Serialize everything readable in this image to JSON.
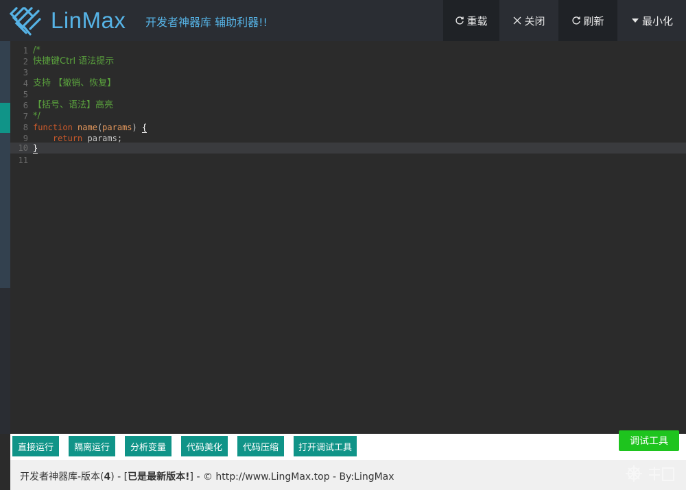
{
  "header": {
    "brand": "LinMax",
    "slogan": "开发者神器库 辅助利器!!",
    "nav": [
      {
        "label": "重载",
        "icon": "reload-icon"
      },
      {
        "label": "关闭",
        "icon": "close-icon"
      },
      {
        "label": "刷新",
        "icon": "refresh-icon"
      },
      {
        "label": "最小化",
        "icon": "caret-down-icon"
      }
    ]
  },
  "editor": {
    "lines": [
      "1",
      "2",
      "3",
      "4",
      "5",
      "6",
      "7",
      "8",
      "9",
      "10",
      "11"
    ],
    "code": {
      "l1": "/*",
      "l2": "快捷键Ctrl 语法提示",
      "l4": "支持 【撤销、恢复】",
      "l6": "【括号、语法】高亮",
      "l7": "*/",
      "l8_kw": "function",
      "l8_fn": "name",
      "l8_open": "(",
      "l8_param": "params",
      "l8_close": ") ",
      "l8_brace": "{",
      "l9_indent": "    ",
      "l9_kw": "return",
      "l9_rest": " params;",
      "l10": "}"
    }
  },
  "toolbar": {
    "buttons": [
      "直接运行",
      "隔离运行",
      "分析变量",
      "代码美化",
      "代码压缩",
      "打开调试工具"
    ],
    "debug": "调试工具"
  },
  "footer": {
    "prefix": "开发者神器库-版本(",
    "version": "4",
    "mid": ") - [",
    "status": "已是最新版本!",
    "suffix": "] - © http://www.LingMax.top - By:LingMax"
  },
  "colors": {
    "accent_teal": "#109488",
    "accent_green": "#1ec41e",
    "brand_blue": "#56b3e6"
  }
}
